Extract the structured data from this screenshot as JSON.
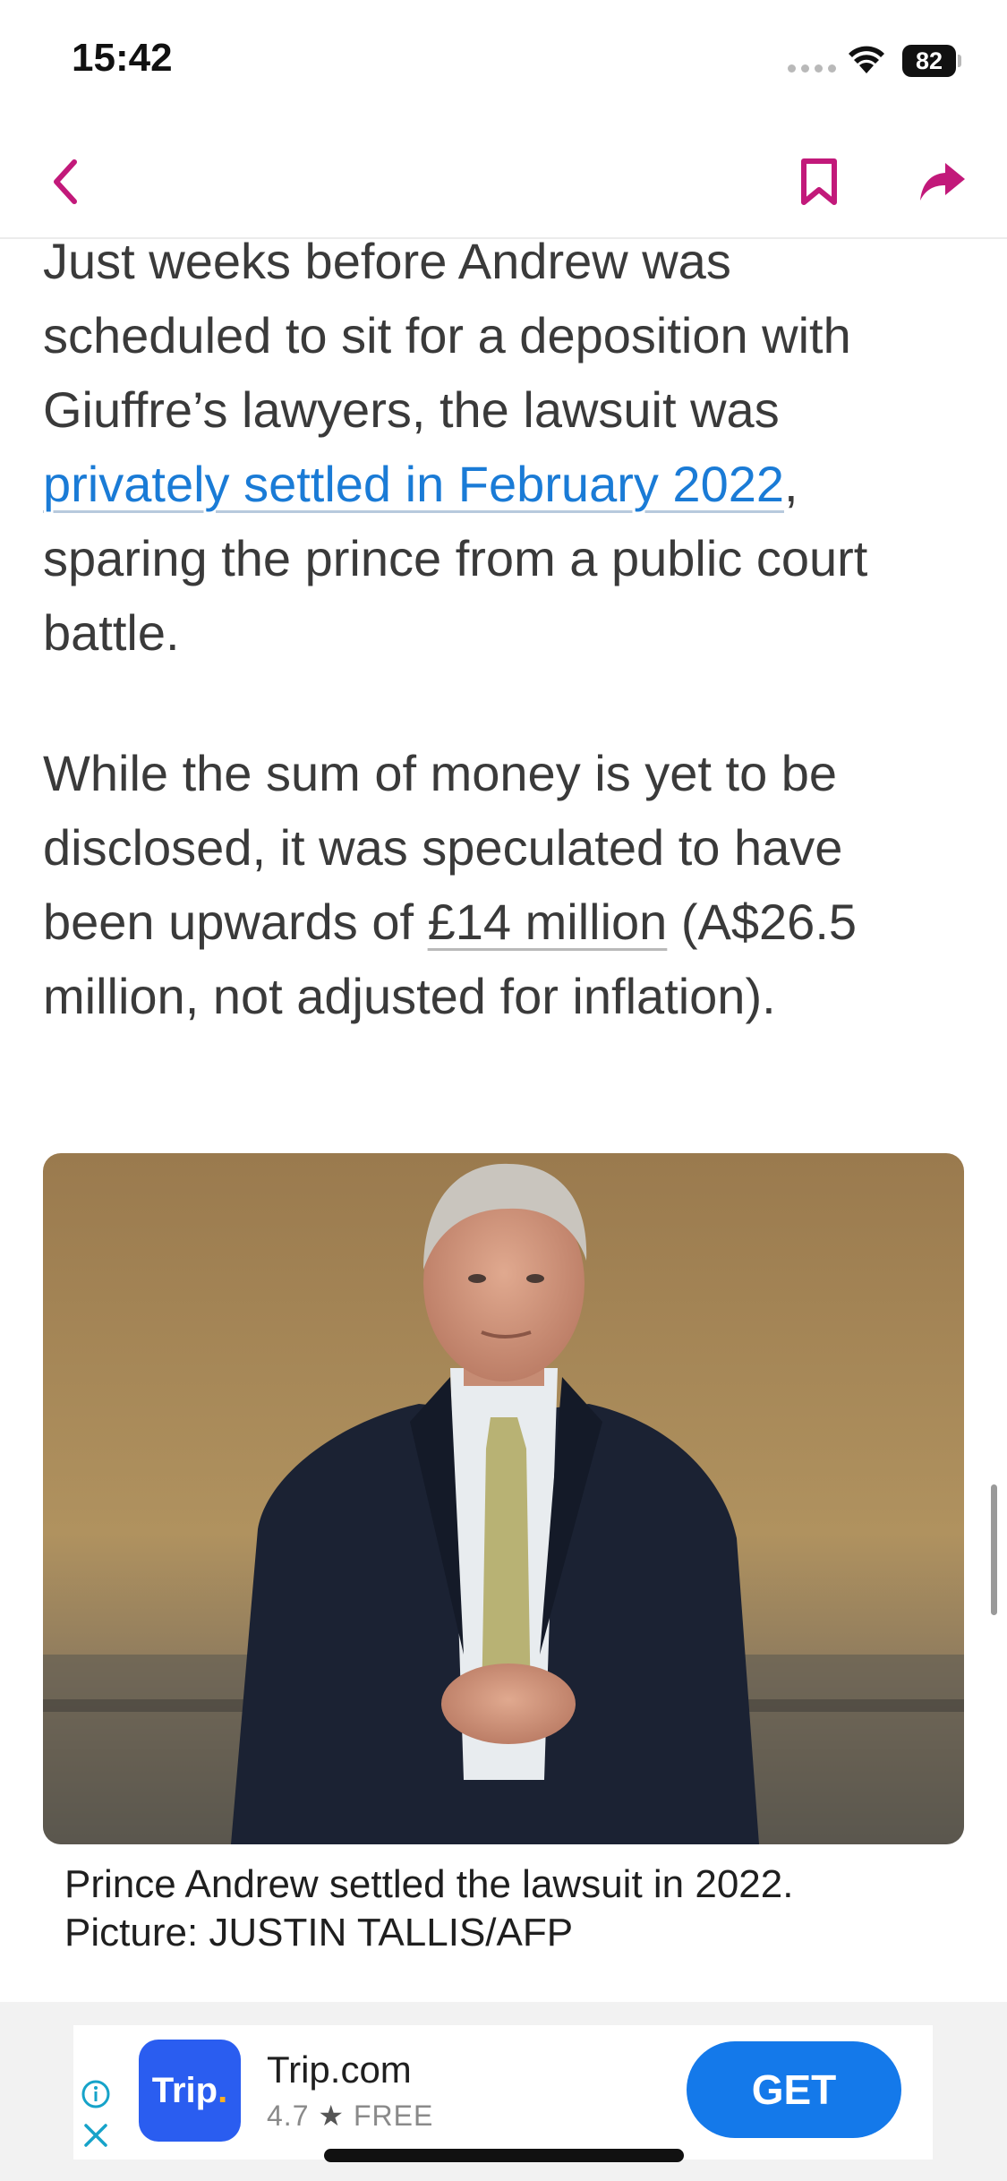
{
  "status_bar": {
    "time": "15:42",
    "battery": "82"
  },
  "nav": {
    "back": "back-icon",
    "bookmark": "bookmark-icon",
    "share": "share-icon",
    "accent_color": "#c2197a"
  },
  "article": {
    "p1_before": "Just weeks before Andrew was scheduled to sit for a deposition with Giuffre’s lawyers, the lawsuit was ",
    "p1_link": "privately settled in February 2022",
    "p1_after": ", sparing the prince from a public court battle.",
    "p2_before": "While the sum of money is yet to be disclosed, it was speculated to have been upwards of ",
    "p2_link": "£14 million",
    "p2_after": " (A$26.5 million, not adjusted for inflation)."
  },
  "figure": {
    "caption_line1": "Prince Andrew settled the lawsuit in 2022.",
    "caption_line2": "Picture: JUSTIN TALLIS/AFP"
  },
  "ad": {
    "icon_text": "Trip",
    "icon_dot": ".",
    "app_name": "Trip.com",
    "rating": "4.7",
    "price": "FREE",
    "cta": "GET"
  }
}
